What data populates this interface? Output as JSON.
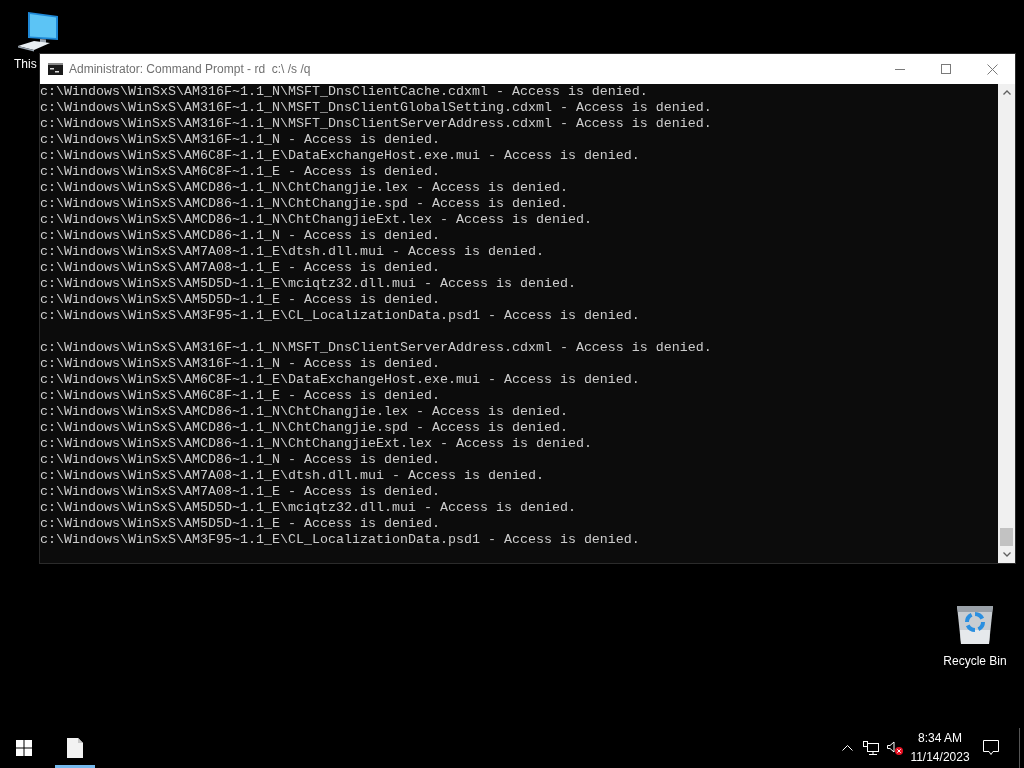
{
  "desktop_icons": [
    {
      "kind": "computer",
      "label": "This"
    },
    {
      "kind": "recycle_bin",
      "label": "Recycle Bin"
    }
  ],
  "window": {
    "title": "Administrator: Command Prompt - rd  c:\\ /s /q",
    "console_blocks": [
      [
        "c:\\Windows\\WinSxS\\AM316F~1.1_N\\MSFT_DnsClientCache.cdxml - Access is denied.",
        "c:\\Windows\\WinSxS\\AM316F~1.1_N\\MSFT_DnsClientGlobalSetting.cdxml - Access is denied.",
        "c:\\Windows\\WinSxS\\AM316F~1.1_N\\MSFT_DnsClientServerAddress.cdxml - Access is denied.",
        "c:\\Windows\\WinSxS\\AM316F~1.1_N - Access is denied.",
        "c:\\Windows\\WinSxS\\AM6C8F~1.1_E\\DataExchangeHost.exe.mui - Access is denied.",
        "c:\\Windows\\WinSxS\\AM6C8F~1.1_E - Access is denied.",
        "c:\\Windows\\WinSxS\\AMCD86~1.1_N\\ChtChangjie.lex - Access is denied.",
        "c:\\Windows\\WinSxS\\AMCD86~1.1_N\\ChtChangjie.spd - Access is denied.",
        "c:\\Windows\\WinSxS\\AMCD86~1.1_N\\ChtChangjieExt.lex - Access is denied.",
        "c:\\Windows\\WinSxS\\AMCD86~1.1_N - Access is denied.",
        "c:\\Windows\\WinSxS\\AM7A08~1.1_E\\dtsh.dll.mui - Access is denied.",
        "c:\\Windows\\WinSxS\\AM7A08~1.1_E - Access is denied.",
        "c:\\Windows\\WinSxS\\AM5D5D~1.1_E\\mciqtz32.dll.mui - Access is denied.",
        "c:\\Windows\\WinSxS\\AM5D5D~1.1_E - Access is denied.",
        "c:\\Windows\\WinSxS\\AM3F95~1.1_E\\CL_LocalizationData.psd1 - Access is denied."
      ],
      [
        "c:\\Windows\\WinSxS\\AM316F~1.1_N\\MSFT_DnsClientServerAddress.cdxml - Access is denied.",
        "c:\\Windows\\WinSxS\\AM316F~1.1_N - Access is denied.",
        "c:\\Windows\\WinSxS\\AM6C8F~1.1_E\\DataExchangeHost.exe.mui - Access is denied.",
        "c:\\Windows\\WinSxS\\AM6C8F~1.1_E - Access is denied.",
        "c:\\Windows\\WinSxS\\AMCD86~1.1_N\\ChtChangjie.lex - Access is denied.",
        "c:\\Windows\\WinSxS\\AMCD86~1.1_N\\ChtChangjie.spd - Access is denied.",
        "c:\\Windows\\WinSxS\\AMCD86~1.1_N\\ChtChangjieExt.lex - Access is denied.",
        "c:\\Windows\\WinSxS\\AMCD86~1.1_N - Access is denied.",
        "c:\\Windows\\WinSxS\\AM7A08~1.1_E\\dtsh.dll.mui - Access is denied.",
        "c:\\Windows\\WinSxS\\AM7A08~1.1_E - Access is denied.",
        "c:\\Windows\\WinSxS\\AM5D5D~1.1_E\\mciqtz32.dll.mui - Access is denied.",
        "c:\\Windows\\WinSxS\\AM5D5D~1.1_E - Access is denied.",
        "c:\\Windows\\WinSxS\\AM3F95~1.1_E\\CL_LocalizationData.psd1 - Access is denied."
      ]
    ]
  },
  "taskbar": {
    "apps": [
      {
        "kind": "document",
        "selected": true
      }
    ],
    "volume": {
      "muted": true
    },
    "clock": {
      "time": "8:34 AM",
      "date": "11/14/2023"
    }
  }
}
